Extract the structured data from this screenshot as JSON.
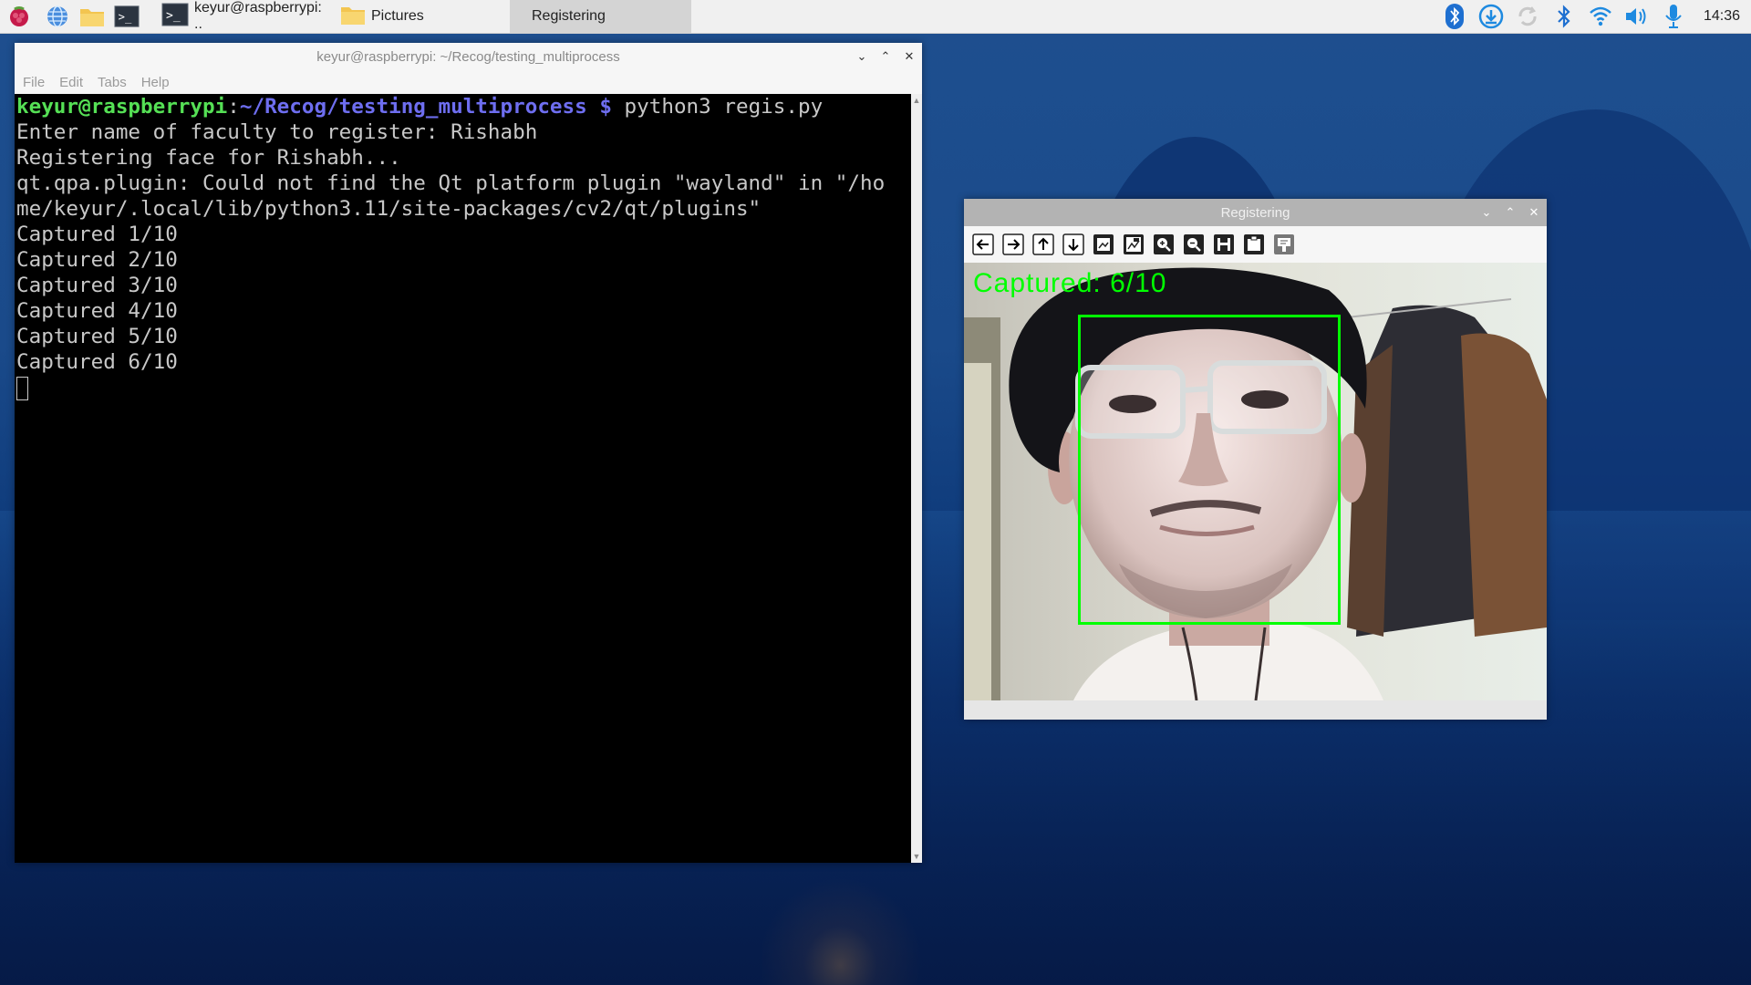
{
  "taskbar": {
    "icons": [
      "raspberry-menu-icon",
      "browser-globe-icon",
      "file-manager-folder-icon",
      "terminal-launcher-icon"
    ],
    "tasks": [
      {
        "label": "keyur@raspberrypi: ..",
        "icon": "terminal-icon",
        "active": false
      },
      {
        "label": "Pictures",
        "icon": "folder-icon",
        "active": false
      },
      {
        "label": "Registering",
        "icon": "",
        "active": true
      }
    ],
    "tray": [
      "bluetooth-badge-icon",
      "update-download-icon",
      "sync-icon",
      "bluetooth-icon",
      "wifi-icon",
      "volume-icon",
      "microphone-icon"
    ],
    "clock": "14:36"
  },
  "terminal": {
    "title": "keyur@raspberrypi: ~/Recog/testing_multiprocess",
    "menu": [
      "File",
      "Edit",
      "Tabs",
      "Help"
    ],
    "prompt_user": "keyur@raspberrypi",
    "prompt_sep": ":",
    "prompt_path": "~/Recog/testing_multiprocess $",
    "command": " python3 regis.py",
    "lines": [
      "Enter name of faculty to register: Rishabh",
      "Registering face for Rishabh...",
      "qt.qpa.plugin: Could not find the Qt platform plugin \"wayland\" in \"/ho",
      "me/keyur/.local/lib/python3.11/site-packages/cv2/qt/plugins\"",
      "Captured 1/10",
      "Captured 2/10",
      "Captured 3/10",
      "Captured 4/10",
      "Captured 5/10",
      "Captured 6/10"
    ]
  },
  "viewer": {
    "title": "Registering",
    "tools": [
      "pan-left-icon",
      "pan-right-icon",
      "pan-up-icon",
      "pan-down-icon",
      "zoom-fit-icon",
      "zoom-original-icon",
      "zoom-in-icon",
      "zoom-out-icon",
      "save-image-icon",
      "copy-clipboard-icon",
      "properties-icon"
    ],
    "overlay_text": "Captured: 6/10",
    "colors": {
      "box": "#00ff00",
      "text": "#00ff00"
    }
  }
}
